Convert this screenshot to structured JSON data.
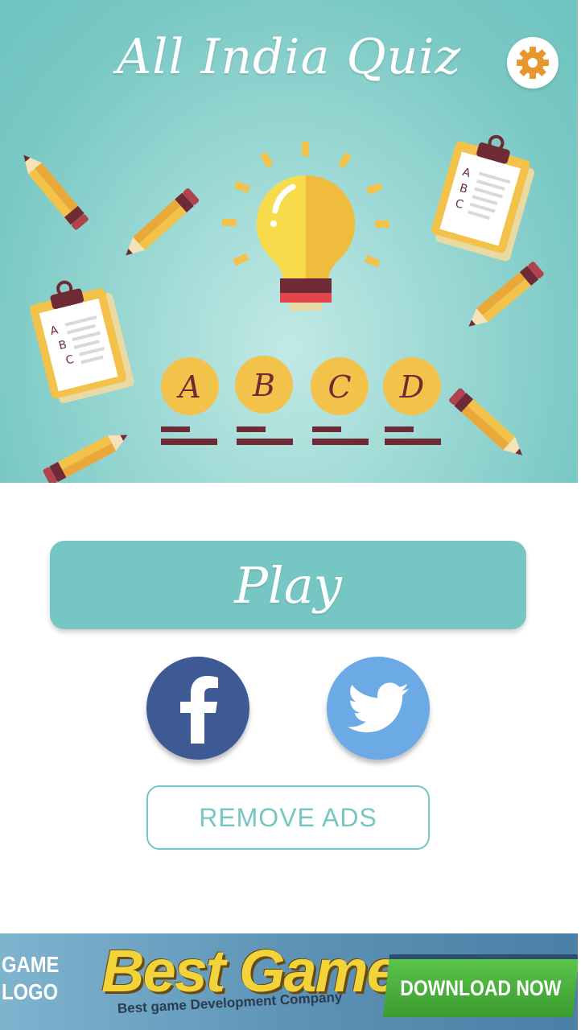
{
  "header": {
    "title": "All India Quiz",
    "settings_icon": "gear-icon"
  },
  "illustration": {
    "options": [
      "A",
      "B",
      "C",
      "D"
    ],
    "clipboard_letters": [
      "A",
      "B",
      "C"
    ]
  },
  "menu": {
    "play_label": "Play",
    "facebook_icon": "facebook-icon",
    "twitter_icon": "twitter-icon",
    "remove_ads_label": "REMOVE ADS"
  },
  "ad": {
    "logo_line1": "GAME",
    "logo_line2": "LOGO",
    "title": "Best Game",
    "subtitle": "Best game Development Company",
    "cta": "DOWNLOAD NOW"
  },
  "colors": {
    "teal": "#76c7c3",
    "facebook": "#3d5a94",
    "twitter": "#6caae6",
    "settings_orange": "#e8962e",
    "bulb_yellow": "#f3c24a",
    "maroon": "#6e2a35"
  }
}
